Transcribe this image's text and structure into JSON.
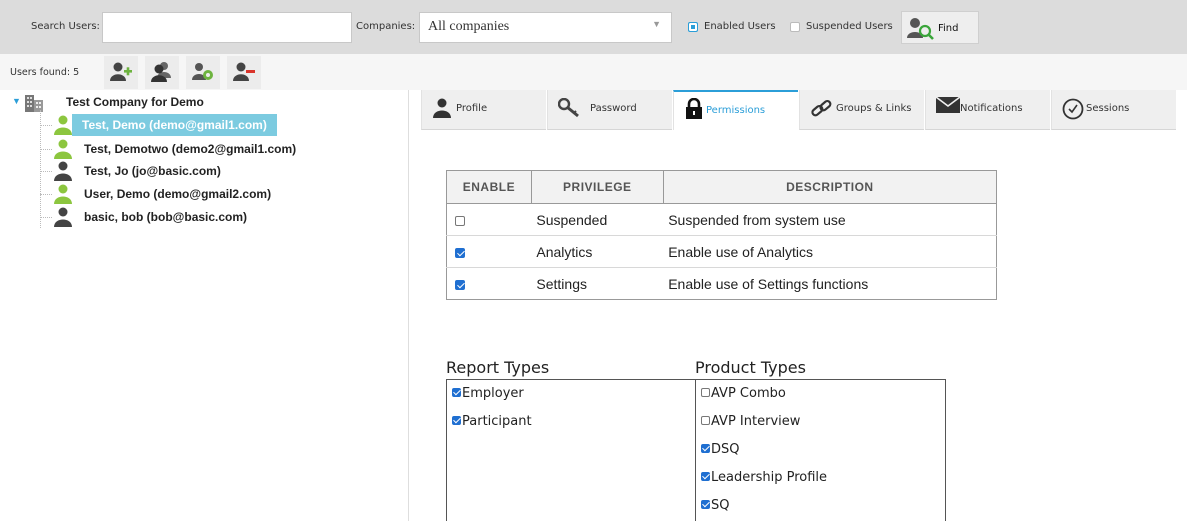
{
  "search": {
    "label": "Search Users:",
    "value": "",
    "placeholder": ""
  },
  "companies": {
    "label": "Companies:",
    "selected": "All companies"
  },
  "filters": [
    {
      "label": "Enabled Users",
      "checked": true
    },
    {
      "label": "Suspended Users",
      "checked": false
    }
  ],
  "find": {
    "label": "Find"
  },
  "users_found": "Users found: 5",
  "toolbar_icons": [
    "add-user-icon",
    "users-icon",
    "user-settings-icon",
    "remove-user-icon"
  ],
  "tree": {
    "company": "Test Company for Demo",
    "users": [
      {
        "label": "Test, Demo  (demo@gmail1.com)",
        "enabled": true,
        "selected": true
      },
      {
        "label": "Test, Demotwo  (demo2@gmail1.com)",
        "enabled": true,
        "selected": false
      },
      {
        "label": "Test, Jo  (jo@basic.com)",
        "enabled": false,
        "selected": false
      },
      {
        "label": "User, Demo  (demo@gmail2.com)",
        "enabled": true,
        "selected": false
      },
      {
        "label": "basic, bob  (bob@basic.com)",
        "enabled": false,
        "selected": false
      }
    ]
  },
  "tabs": [
    {
      "label": "Profile",
      "icon": "person-icon",
      "active": false
    },
    {
      "label": "Password",
      "icon": "key-icon",
      "active": false
    },
    {
      "label": "Permissions",
      "icon": "lock-icon",
      "active": true
    },
    {
      "label": "Groups & Links",
      "icon": "link-icon",
      "active": false
    },
    {
      "label": "Notifications",
      "icon": "envelope-icon",
      "active": false
    },
    {
      "label": "Sessions",
      "icon": "clock-icon",
      "active": false
    }
  ],
  "privileges": {
    "headers": [
      "ENABLE",
      "PRIVILEGE",
      "DESCRIPTION"
    ],
    "rows": [
      {
        "enabled": false,
        "privilege": "Suspended",
        "description": "Suspended from system use"
      },
      {
        "enabled": true,
        "privilege": "Analytics",
        "description": "Enable use of Analytics"
      },
      {
        "enabled": true,
        "privilege": "Settings",
        "description": "Enable use of Settings functions"
      }
    ]
  },
  "report_types": {
    "title": "Report Types",
    "items": [
      {
        "label": "Employer",
        "checked": true
      },
      {
        "label": "Participant",
        "checked": true
      }
    ]
  },
  "product_types": {
    "title": "Product Types",
    "items": [
      {
        "label": "AVP Combo",
        "checked": false
      },
      {
        "label": "AVP Interview",
        "checked": false
      },
      {
        "label": "DSQ",
        "checked": true
      },
      {
        "label": "Leadership Profile",
        "checked": true
      },
      {
        "label": "SQ",
        "checked": true
      }
    ]
  },
  "colors": {
    "accent": "#2b9ed8",
    "selection": "#7ccbe0",
    "user_enabled": "#8cc63f",
    "user_disabled": "#444444"
  }
}
